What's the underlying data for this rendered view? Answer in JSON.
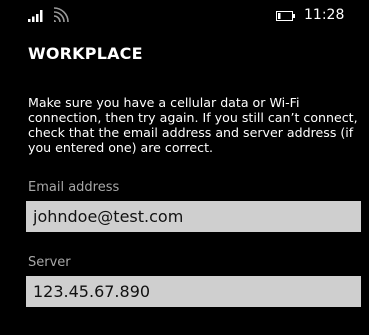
{
  "status_bar": {
    "time": "11:28",
    "icons": [
      "signal-strength-icon",
      "wifi-icon",
      "battery-icon"
    ]
  },
  "header": {
    "title": "WORKPLACE"
  },
  "message": {
    "text": "Make sure you have a cellular data or Wi-Fi connection, then try again. If you still can’t connect, check that the email address and server address (if you entered one) are correct."
  },
  "form": {
    "email": {
      "label": "Email address",
      "value": "johndoe@test.com"
    },
    "server": {
      "label": "Server",
      "value": "123.45.67.890"
    }
  },
  "colors": {
    "background": "#000000",
    "text": "#ffffff",
    "label": "#a8a8a8",
    "input_background": "#cfcfcf"
  }
}
